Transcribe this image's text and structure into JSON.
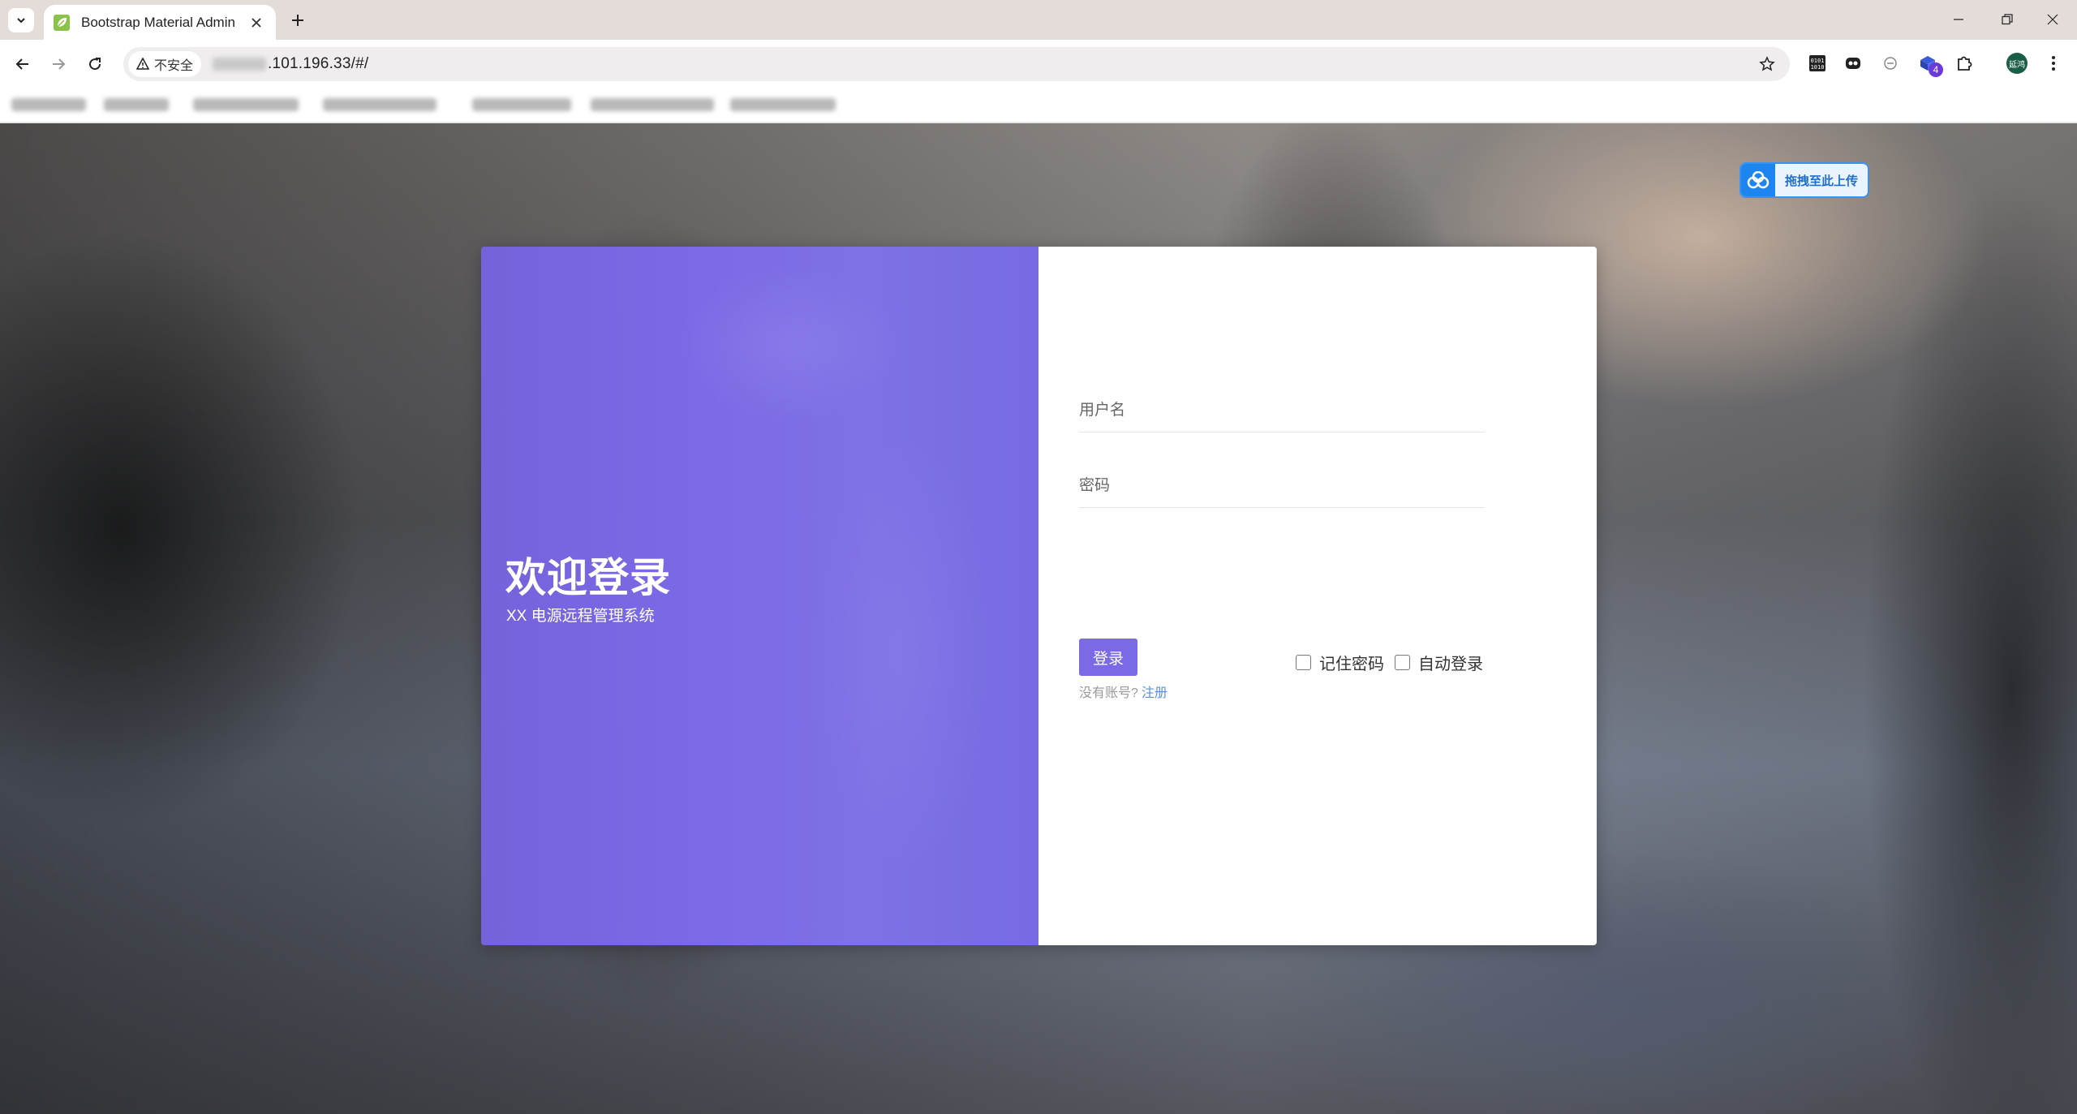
{
  "browser": {
    "tab_title": "Bootstrap Material Admin",
    "security_label": "不安全",
    "url": ".101.196.33/#/",
    "extension_badge": "4",
    "profile_label": "延鸿"
  },
  "upload_widget": {
    "label": "拖拽至此上传"
  },
  "welcome": {
    "title": "欢迎登录",
    "subtitle": "XX 电源远程管理系统"
  },
  "form": {
    "username_placeholder": "用户名",
    "password_placeholder": "密码",
    "login_button": "登录",
    "remember_password": "记住密码",
    "auto_login": "自动登录",
    "no_account": "没有账号?",
    "register_link": "注册"
  },
  "colors": {
    "brand_purple": "#7b6ae6",
    "link_blue": "#5a8fde",
    "upload_blue": "#1d85f0"
  }
}
